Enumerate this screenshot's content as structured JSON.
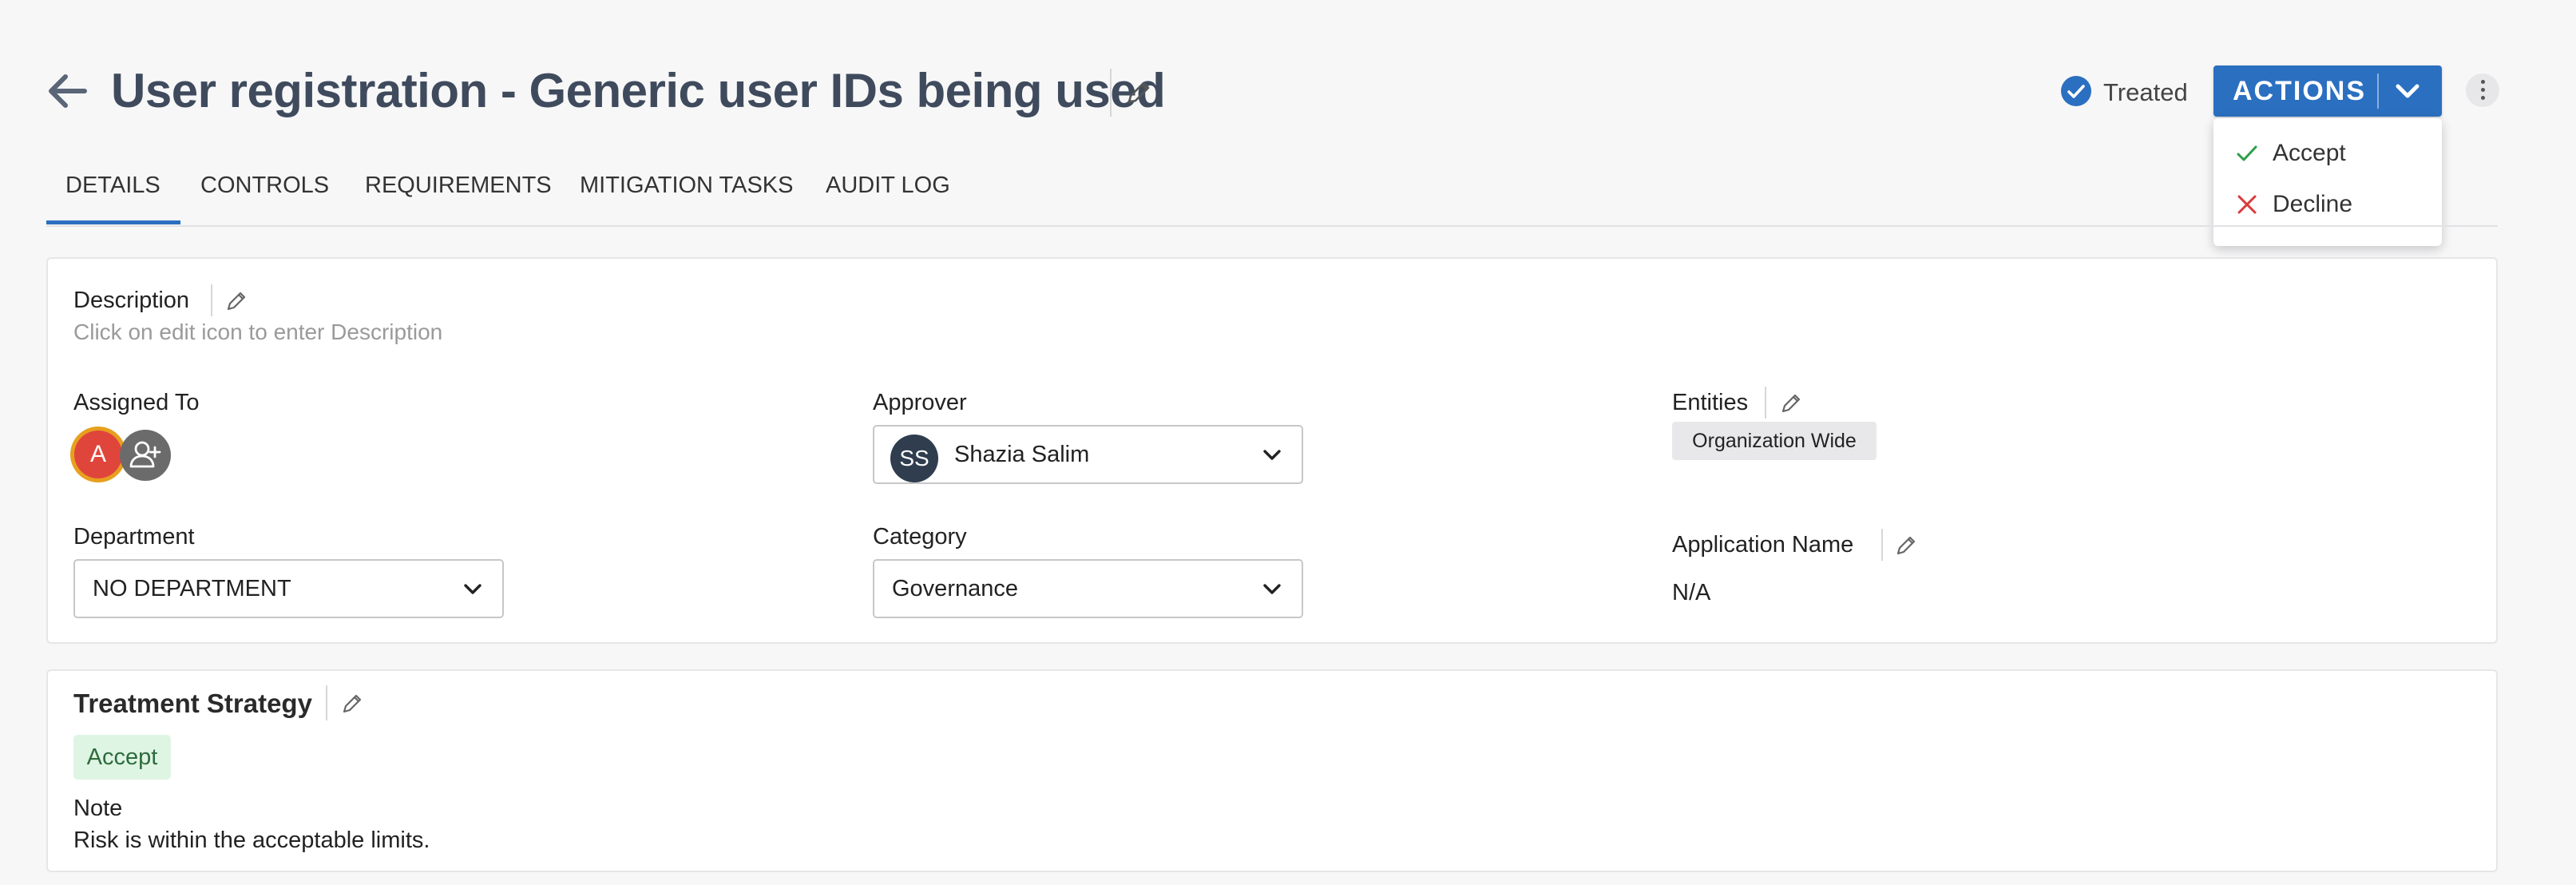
{
  "header": {
    "title": "User registration - Generic user IDs being used",
    "status_text": "Treated",
    "actions_label": "ACTIONS"
  },
  "actions_menu": {
    "items": [
      {
        "label": "Accept",
        "icon": "check-icon",
        "color": "#2e9e48"
      },
      {
        "label": "Decline",
        "icon": "x-icon",
        "color": "#d93b3b"
      }
    ]
  },
  "tabs": [
    {
      "label": "DETAILS",
      "active": true
    },
    {
      "label": "CONTROLS",
      "active": false
    },
    {
      "label": "REQUIREMENTS",
      "active": false
    },
    {
      "label": "MITIGATION TASKS",
      "active": false
    },
    {
      "label": "AUDIT LOG",
      "active": false
    }
  ],
  "details": {
    "description_label": "Description",
    "description_placeholder": "Click on edit icon to enter Description",
    "assigned_to_label": "Assigned To",
    "assigned_avatar_initial": "A",
    "approver_label": "Approver",
    "approver_initials": "SS",
    "approver_name": "Shazia Salim",
    "entities_label": "Entities",
    "entities_value": "Organization Wide",
    "department_label": "Department",
    "department_value": "NO DEPARTMENT",
    "category_label": "Category",
    "category_value": "Governance",
    "application_name_label": "Application Name",
    "application_name_value": "N/A"
  },
  "treatment": {
    "title": "Treatment Strategy",
    "strategy": "Accept",
    "note_label": "Note",
    "note_value": "Risk is within the acceptable limits."
  },
  "colors": {
    "accent": "#2b6fc0",
    "title_text": "#3f4b5d",
    "avatar_a": "#e0453c",
    "avatar_ring": "#e7a01e",
    "strategy_bg": "#dff5e4"
  }
}
